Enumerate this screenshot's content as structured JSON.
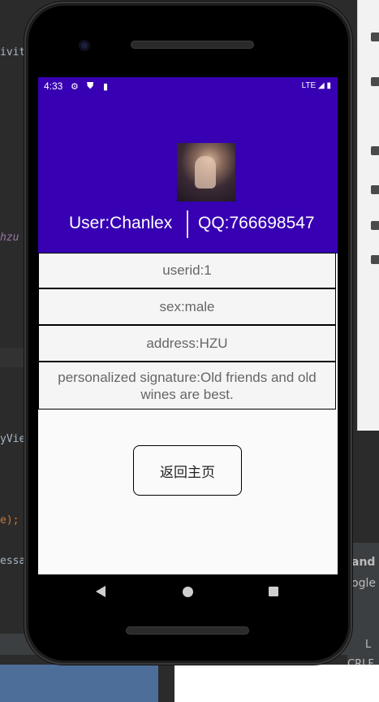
{
  "ide": {
    "code_fragments": [
      "ivit",
      "hzu",
      "yVie",
      "e);",
      "essa"
    ],
    "panel_text": "and",
    "panel_text2": "ogle",
    "panel_text3": "L",
    "encoding": "CRLF"
  },
  "status_bar": {
    "time": "4:33",
    "network": "LTE"
  },
  "profile": {
    "user_label": "User:Chanlex",
    "qq_label": "QQ:766698547"
  },
  "info": {
    "userid": "userid:1",
    "sex": "sex:male",
    "address": "address:HZU",
    "signature": "personalized signature:Old friends and old wines are best."
  },
  "actions": {
    "back_label": "返回主页"
  }
}
